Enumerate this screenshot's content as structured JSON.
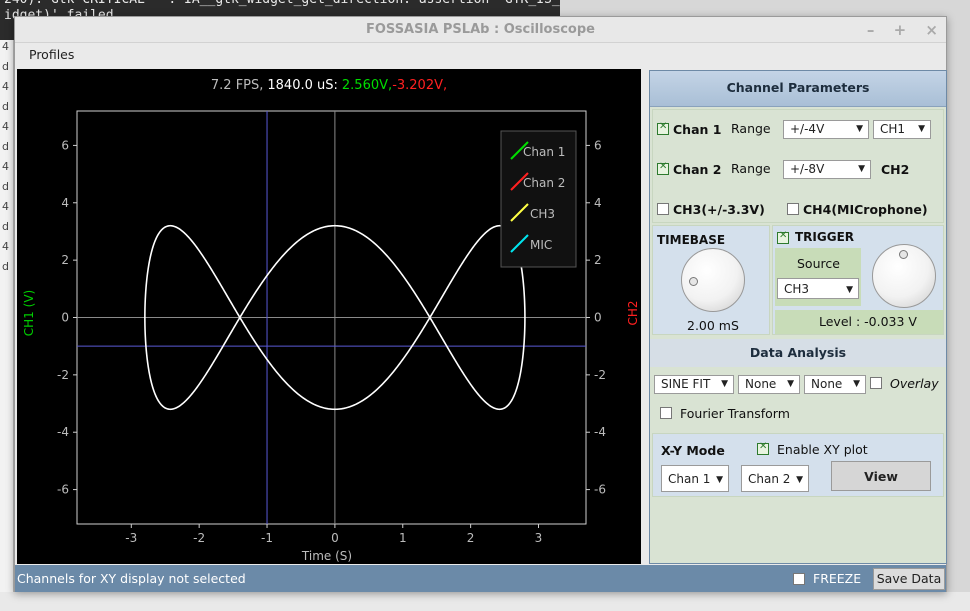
{
  "terminal": {
    "lines": [
      "240): Gtk-CRITICAL **: IA__gtk_widget_get_direction: assertion 'GTK_IS_",
      "idget)' failed"
    ]
  },
  "bg_strip": {
    "letters": [
      "4",
      "d",
      "4",
      "d",
      "4",
      "d",
      "4",
      "d",
      "4",
      "d",
      "4",
      "d"
    ]
  },
  "window": {
    "title": "FOSSASIA PSLAb : Oscilloscope",
    "controls": {
      "minimize": "–",
      "maximize": "+",
      "close": "×"
    }
  },
  "menu": {
    "profiles": "Profiles"
  },
  "readout": {
    "fps": "7.2 FPS,",
    "time": "1840.0 uS:",
    "v1": "2.560V,",
    "v2": "-3.202V,"
  },
  "colors": {
    "ch1": "#00dd00",
    "ch2": "#ff2020",
    "ch3": "#ffff44",
    "mic": "#00e5ee",
    "trace": "#ffffff",
    "cursor": "#5a5ad6"
  },
  "chart_data": {
    "type": "line",
    "xlabel": "Time (S)",
    "ylabel": "CH1 (V)",
    "y2label": "CH2",
    "xlim": [
      -3.8,
      3.7
    ],
    "ylim": [
      -7.2,
      7.2
    ],
    "x_ticks": [
      "-3",
      "-2",
      "-1",
      "0",
      "1",
      "2",
      "3"
    ],
    "y_ticks": [
      "6",
      "4",
      "2",
      "0",
      "-2",
      "-4",
      "-6"
    ],
    "y2_ticks": [
      "6",
      "4",
      "2",
      "0",
      "-2",
      "-4",
      "-6"
    ],
    "cursor": {
      "x": -1.0,
      "y": -1.0
    },
    "legend": {
      "placement": "top-right",
      "entries": [
        "Chan 1",
        "Chan 2",
        "CH3",
        "MIC"
      ]
    },
    "curve": {
      "x_amplitude": 2.8,
      "x_freq": 1,
      "y_amplitude": 3.2,
      "y_freq": 3,
      "y_phase_deg": 90
    }
  },
  "panel": {
    "channel_params_title": "Channel Parameters",
    "chan1": {
      "label": "Chan 1",
      "range_label": "Range",
      "range": "+/-4V",
      "source": "CH1"
    },
    "chan2": {
      "label": "Chan 2",
      "range_label": "Range",
      "range": "+/-8V",
      "source": "CH2"
    },
    "ch3": "CH3(+/-3.3V)",
    "ch4": "CH4(MICrophone)",
    "timebase": {
      "title": "TIMEBASE",
      "value": "2.00 mS"
    },
    "trigger": {
      "title": "TRIGGER",
      "source_label": "Source",
      "source": "CH3",
      "level": "Level : -0.033 V"
    },
    "analysis": {
      "title": "Data Analysis",
      "fit": "SINE FIT",
      "opt1": "None",
      "opt2": "None",
      "overlay": "Overlay",
      "fourier": "Fourier Transform"
    },
    "xy": {
      "title": "X-Y Mode",
      "enable": "Enable XY plot",
      "x_channel": "Chan 1",
      "y_channel": "Chan 2",
      "view": "View"
    }
  },
  "status": {
    "message": "Channels for XY display not selected",
    "freeze": "FREEZE",
    "save": "Save Data"
  }
}
